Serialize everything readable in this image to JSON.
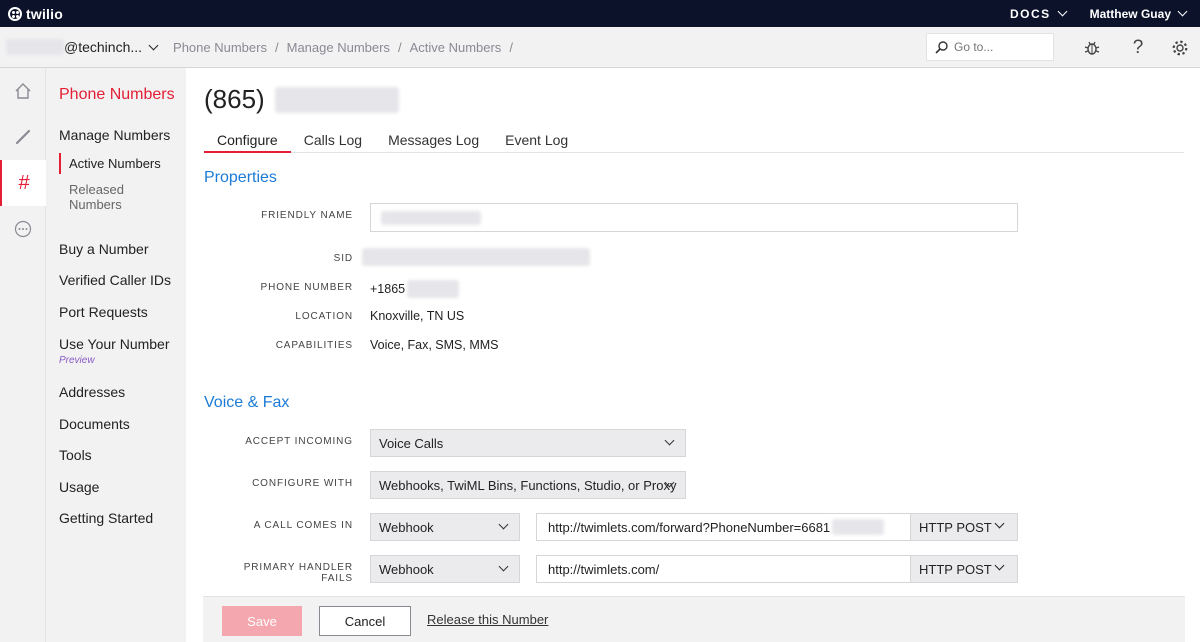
{
  "topbar": {
    "logo": "twilio",
    "docs_label": "DOCS",
    "user_name": "Matthew Guay"
  },
  "breadcrumb": {
    "account": "@techinch...",
    "items": [
      "Phone Numbers",
      "Manage Numbers",
      "Active Numbers"
    ],
    "separator": "/"
  },
  "search": {
    "placeholder": "Go to..."
  },
  "rail": {
    "icons": [
      "home-icon",
      "phone-handset-icon",
      "hash-icon",
      "more-icon"
    ],
    "active_icon": "hash-icon",
    "hash_glyph": "#"
  },
  "sidenav": {
    "title": "Phone Numbers",
    "group": "Manage Numbers",
    "subitems": [
      "Active Numbers",
      "Released",
      "Numbers"
    ],
    "links": [
      "Buy a Number",
      "Verified Caller IDs",
      "Port Requests",
      "Use Your Number",
      "Addresses",
      "Documents",
      "Tools",
      "Usage",
      "Getting Started"
    ],
    "preview_badge": "Preview"
  },
  "main": {
    "phone_prefix": "(865)",
    "tabs": [
      "Configure",
      "Calls Log",
      "Messages Log",
      "Event Log"
    ],
    "active_tab": "Configure",
    "properties": {
      "heading": "Properties",
      "friendly_name_label": "FRIENDLY NAME",
      "sid_label": "SID",
      "phone_number_label": "PHONE NUMBER",
      "phone_number_value": "+1865",
      "location_label": "LOCATION",
      "location_value": "Knoxville, TN US",
      "capabilities_label": "CAPABILITIES",
      "capabilities_value": "Voice, Fax, SMS, MMS"
    },
    "voice": {
      "heading": "Voice & Fax",
      "accept_incoming_label": "ACCEPT INCOMING",
      "accept_incoming_value": "Voice Calls",
      "configure_with_label": "CONFIGURE WITH",
      "configure_with_value": "Webhooks, TwiML Bins, Functions, Studio, or Proxy",
      "call_comes_in_label": "A CALL COMES IN",
      "call_comes_in_type": "Webhook",
      "call_comes_in_url": "http://twimlets.com/forward?PhoneNumber=6681",
      "call_comes_in_method": "HTTP POST",
      "primary_fails_label": "PRIMARY HANDLER FAILS",
      "primary_fails_type": "Webhook",
      "primary_fails_url": "http://twimlets.com/",
      "primary_fails_method": "HTTP POST"
    }
  },
  "actions": {
    "save": "Save",
    "cancel": "Cancel",
    "release": "Release this Number"
  },
  "colors": {
    "topbar_bg": "#0d122b",
    "brand_red": "#e31e35",
    "link_blue": "#1b7bd6",
    "save_disabled": "#f4a7ae",
    "preview_purple": "#8a5cc2"
  }
}
